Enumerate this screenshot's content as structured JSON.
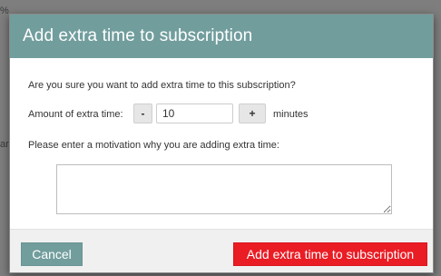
{
  "backdrop": {
    "top_fragment": "%",
    "mid_fragment": "ar"
  },
  "dialog": {
    "title": "Add extra time to subscription",
    "question": "Are you sure you want to add extra time to this subscription?",
    "amount": {
      "label": "Amount of extra time:",
      "decrement_label": "-",
      "value": "10",
      "increment_label": "+",
      "unit": "minutes"
    },
    "motivation": {
      "label": "Please enter a motivation why you are adding extra time:",
      "value": ""
    },
    "buttons": {
      "cancel_label": "Cancel",
      "confirm_label": "Add extra time to subscription"
    }
  },
  "colors": {
    "header": "#729d9d",
    "cancel_button": "#729d9d",
    "confirm_button": "#ea1c24",
    "footer": "#f0f0f0",
    "backdrop": "#7e7e7e"
  }
}
